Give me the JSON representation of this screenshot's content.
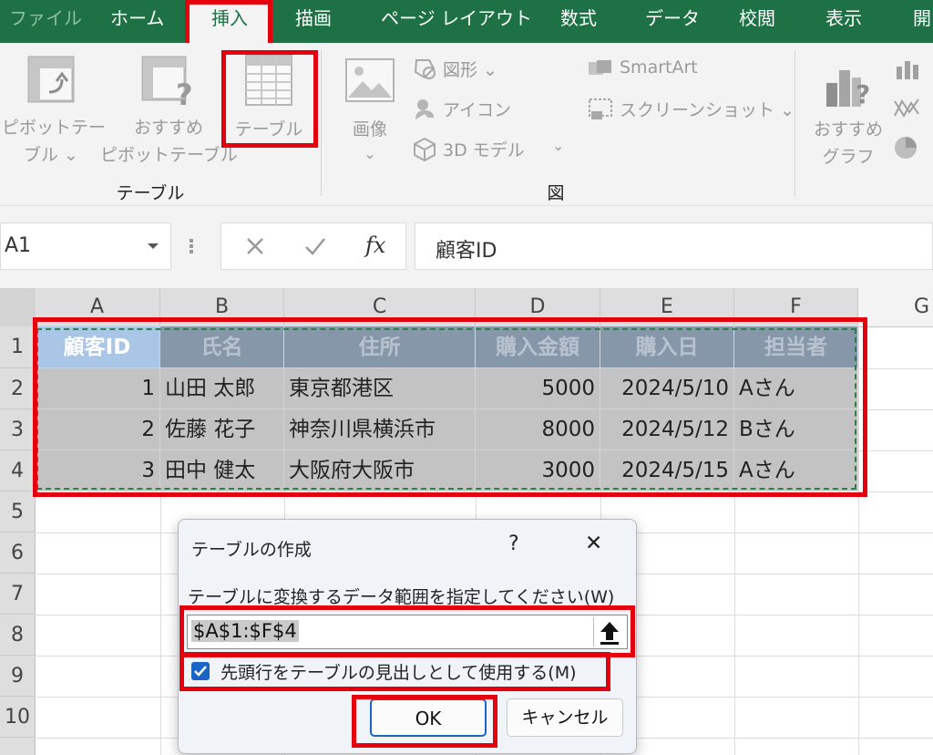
{
  "tabs": [
    "ファイル",
    "ホーム",
    "挿入",
    "描画",
    "ページ レイアウト",
    "数式",
    "データ",
    "校閲",
    "表示",
    "開"
  ],
  "ribbon": {
    "pivot_line1": "ピボットテー",
    "pivot_line2": "ブル ⌄",
    "rec_pivot_line1": "おすすめ",
    "rec_pivot_line2": "ピボットテーブル",
    "table": "テーブル",
    "group_table": "テーブル",
    "image": "画像",
    "image_dropdown": "⌄",
    "shapes": "図形 ⌄",
    "icons": "アイコン",
    "model3d": "3D モデル",
    "model3d_dropdown": "⌄",
    "smartart": "SmartArt",
    "screenshot": "スクリーンショット ⌄",
    "group_illustrations": "図",
    "rec_chart_line1": "おすすめ",
    "rec_chart_line2": "グラフ"
  },
  "formula_bar": {
    "name_box": "A1",
    "fx": "fx",
    "content": "顧客ID"
  },
  "grid": {
    "columns": [
      "A",
      "B",
      "C",
      "D",
      "E",
      "F",
      "G"
    ],
    "rows": [
      "1",
      "2",
      "3",
      "4",
      "5",
      "6",
      "7",
      "8",
      "9",
      "10"
    ],
    "header_row": [
      "顧客ID",
      "氏名",
      "住所",
      "購入金額",
      "購入日",
      "担当者"
    ],
    "data_rows": [
      [
        "1",
        "山田 太郎",
        "東京都港区",
        "5000",
        "2024/5/10",
        "Aさん"
      ],
      [
        "2",
        "佐藤 花子",
        "神奈川県横浜市",
        "8000",
        "2024/5/12",
        "Bさん"
      ],
      [
        "3",
        "田中 健太",
        "大阪府大阪市",
        "3000",
        "2024/5/15",
        "Aさん"
      ]
    ]
  },
  "dialog": {
    "title": "テーブルの作成",
    "help": "?",
    "close": "✕",
    "prompt": "テーブルに変換するデータ範囲を指定してください(W)",
    "range_value": "$A$1:$F$4",
    "checkbox_label": "先頭行をテーブルの見出しとして使用する(M)",
    "checkbox_checked": true,
    "ok": "OK",
    "cancel": "キャンセル"
  },
  "colors": {
    "excel_green": "#1e7145",
    "highlight_red": "#e5000e",
    "checkbox_blue": "#1a64c8"
  }
}
